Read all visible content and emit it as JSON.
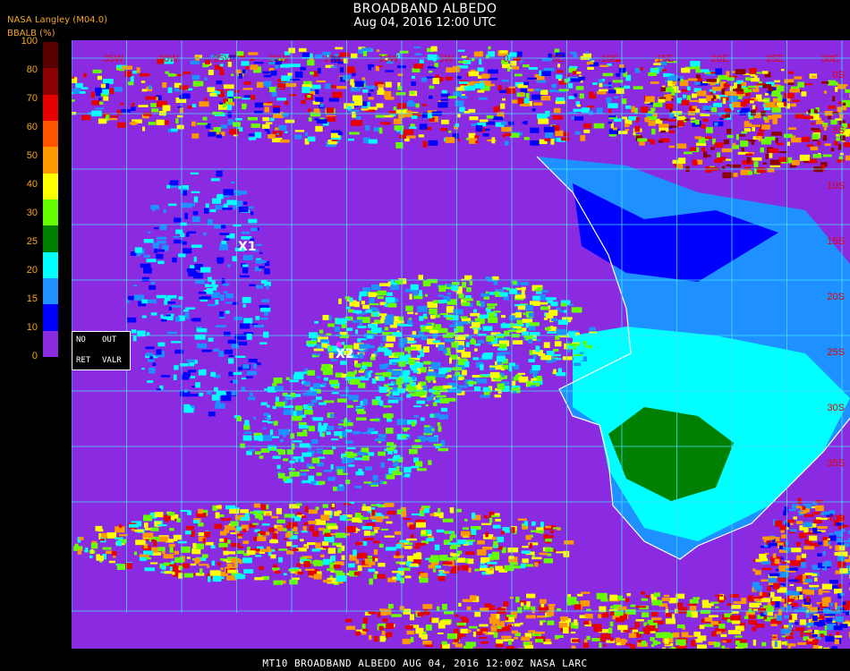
{
  "header": {
    "title": "BROADBAND ALBEDO",
    "subtitle": "Aug 04, 2016 12:00 UTC",
    "source": "NASA Langley (M04.0)"
  },
  "colorbar": {
    "label": "BBALB (%)",
    "ticks": [
      "100",
      "80",
      "70",
      "60",
      "50",
      "40",
      "30",
      "25",
      "20",
      "15",
      "10",
      "0"
    ],
    "colors": [
      "#5a0000",
      "#8b0000",
      "#e60000",
      "#ff5500",
      "#ff9900",
      "#ffff00",
      "#66ff00",
      "#008000",
      "#00ffff",
      "#1e90ff",
      "#0000ff",
      "#8a2be2"
    ],
    "legend": {
      "no": "NO",
      "out": "OUT",
      "ret": "RET",
      "valr": "VALR"
    }
  },
  "map": {
    "markers": [
      {
        "label": "X1"
      },
      {
        "label": "X2"
      }
    ],
    "lon_labels": [
      "35W",
      "30W",
      "25W",
      "20W",
      "15W",
      "10W",
      "5W",
      "0",
      "5E",
      "10E",
      "15E",
      "20E",
      "25E",
      "30E",
      "35E"
    ],
    "lat_labels": [
      "0S",
      "5S",
      "10S",
      "15S",
      "20S",
      "25S",
      "30S",
      "35S",
      "40S"
    ],
    "colors": {
      "grid": "#40e0ff",
      "ocean": "#8a2be2",
      "land_low": "#00ffff",
      "land_veg": "#008000",
      "coast": "#ffffff"
    }
  },
  "footer": {
    "text": "MT10  BROADBAND ALBEDO   AUG 04, 2016 12:00Z   NASA LARC"
  }
}
